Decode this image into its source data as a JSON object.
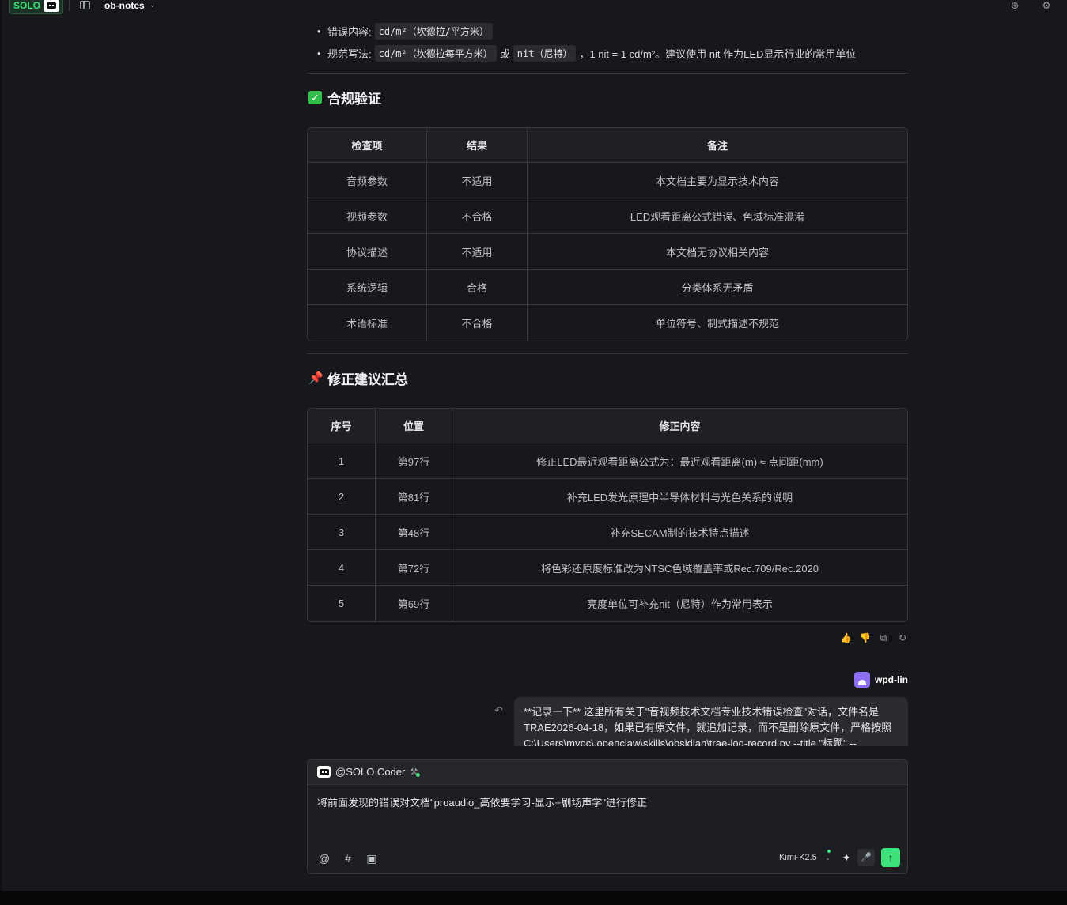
{
  "topbar": {
    "solo_label": "SOLO",
    "project_name": "ob-notes"
  },
  "bullets": {
    "b1_label": "错误内容:",
    "b1_code": "cd/m²（坎德拉/平方米）",
    "b2_label": "规范写法:",
    "b2_code1": "cd/m²（坎德拉每平方米）",
    "b2_or": "或",
    "b2_code2": "nit（尼特）",
    "b2_tail": "，1 nit = 1 cd/m²。建议使用 nit 作为LED显示行业的常用单位"
  },
  "compliance": {
    "title": "合规验证",
    "headers": [
      "检查项",
      "结果",
      "备注"
    ],
    "rows": [
      [
        "音频参数",
        "不适用",
        "本文档主要为显示技术内容"
      ],
      [
        "视频参数",
        "不合格",
        "LED观看距离公式错误、色域标准混淆"
      ],
      [
        "协议描述",
        "不适用",
        "本文档无协议相关内容"
      ],
      [
        "系统逻辑",
        "合格",
        "分类体系无矛盾"
      ],
      [
        "术语标准",
        "不合格",
        "单位符号、制式描述不规范"
      ]
    ]
  },
  "fixes": {
    "title": "修正建议汇总",
    "headers": [
      "序号",
      "位置",
      "修正内容"
    ],
    "rows": [
      [
        "1",
        "第97行",
        "修正LED最近观看距离公式为：最近观看距离(m) ≈ 点间距(mm)"
      ],
      [
        "2",
        "第81行",
        "补充LED发光原理中半导体材料与光色关系的说明"
      ],
      [
        "3",
        "第48行",
        "补充SECAM制的技术特点描述"
      ],
      [
        "4",
        "第72行",
        "将色彩还原度标准改为NTSC色域覆盖率或Rec.709/Rec.2020"
      ],
      [
        "5",
        "第69行",
        "亮度单位可补充nit（尼特）作为常用表示"
      ]
    ]
  },
  "user_message": {
    "username": "wpd-lin",
    "line1": "**记录一下** 这里所有关于\"音视频技术文档专业技术错误检查\"对话，文件名是",
    "line2": "TRAE2026-04-18，如果已有原文件，就追加记录，而不是删除原文件，严格按照",
    "line3": "C:\\Users\\mypc\\.openclaw\\skills\\obsidian\\trae-log-record.py --title \"标题\" --"
  },
  "composer": {
    "agent": "@SOLO Coder",
    "input_text": "将前面发现的错误对文档\"proaudio_高依要学习-显示+剧场声学\"进行修正",
    "model": "Kimi-K2.5"
  },
  "colors": {
    "accent_green": "#3ee07a",
    "avatar_purple": "#8b6ff0",
    "check_green": "#2fbf4a",
    "pin_red": "#e8463a"
  }
}
